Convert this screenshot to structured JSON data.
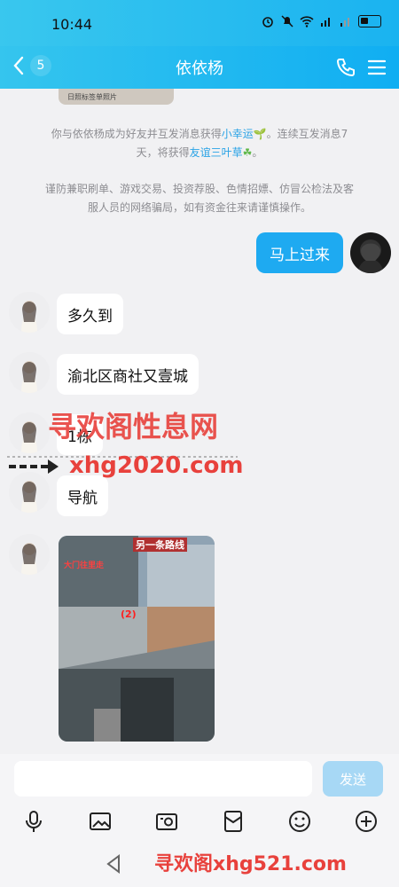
{
  "status": {
    "time": "10:44"
  },
  "header": {
    "badge": "5",
    "title": "依依杨"
  },
  "thumb_text": "日照标签单照片",
  "sys_note_1": {
    "line1_a": "你与依依杨成为好友并互发消息获得",
    "line1_hl": "小幸运",
    "line1_b": "。连续互发消息7",
    "line2_a": "天，将获得",
    "line2_hl": "友谊三叶草",
    "line2_b": "。"
  },
  "sys_note_2": {
    "line1": "谨防兼职刷单、游戏交易、投资荐股、色情招嫖、仿冒公检法及客",
    "line2": "服人员的网络骗局，如有资金往来请谨慎操作。"
  },
  "messages": [
    {
      "side": "right",
      "text": "马上过来"
    },
    {
      "side": "left",
      "text": "多久到"
    },
    {
      "side": "left",
      "text": "渝北区商社又壹城"
    },
    {
      "side": "left",
      "text": "1栋"
    },
    {
      "side": "left",
      "text": "导航"
    }
  ],
  "photo": {
    "label_top": "另一条路线",
    "label_left": "大门往里走",
    "label_num": "(2)"
  },
  "watermarks": {
    "w1": "寻欢阁性息网",
    "w2": "xhg2020.com",
    "w3": "寻欢阁xhg521.com"
  },
  "input": {
    "send_label": "发送"
  },
  "colors": {
    "header": "#1ab3f0",
    "bubble_right": "#1eaaf1",
    "send_disabled": "#a7d8f5",
    "watermark": "#e8413c"
  }
}
